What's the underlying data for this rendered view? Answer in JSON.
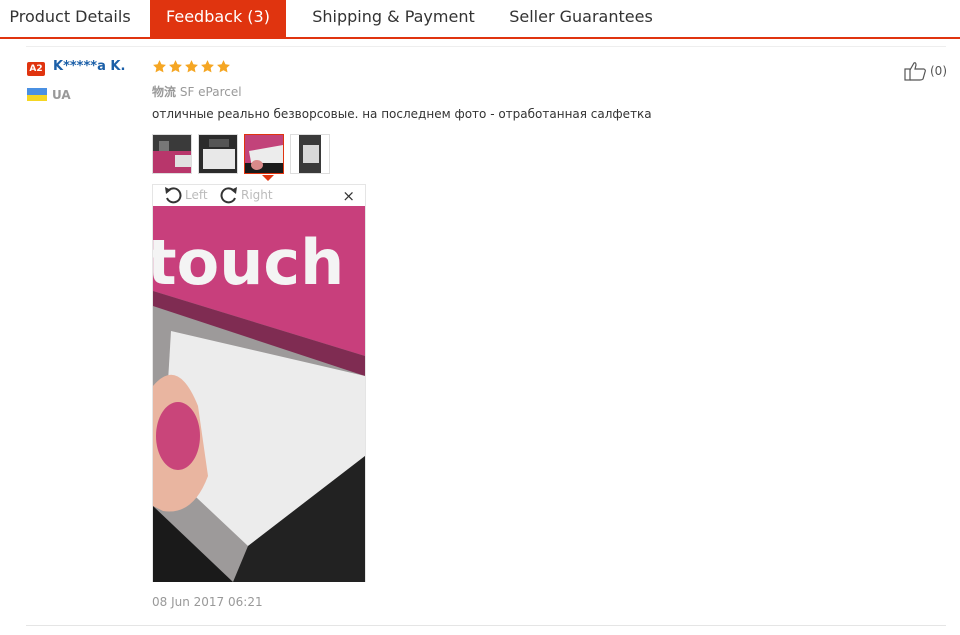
{
  "tabs": [
    {
      "label": "Product Details"
    },
    {
      "label": "Feedback (3)"
    },
    {
      "label": "Shipping & Payment"
    },
    {
      "label": "Seller Guarantees"
    }
  ],
  "feedback": {
    "user": {
      "level": "A2",
      "name": "K*****a K.",
      "country": "UA"
    },
    "rating_stars": 5,
    "shipping": {
      "label": "物流",
      "method": "SF eParcel"
    },
    "text": "отличные реально безворсовые. на последнем фото - отработанная салфетка",
    "images_count": 4,
    "selected_image": 3,
    "viewer": {
      "rotate_left": "Left",
      "rotate_right": "Right",
      "close": "×"
    },
    "photo_text": "touch",
    "date": "08 Jun 2017 06:21",
    "likes": "(0)"
  },
  "colors": {
    "accent": "#e0340f",
    "link": "#1b5fa8",
    "star": "#f5a623"
  }
}
